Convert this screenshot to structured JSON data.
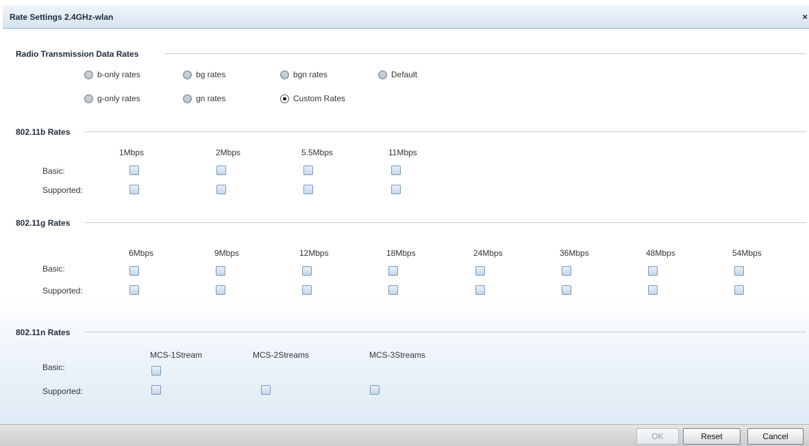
{
  "dialog": {
    "title": "Rate Settings 2.4GHz-wlan",
    "close_glyph": "×"
  },
  "radio_section": {
    "title": "Radio Transmission Data Rates",
    "options": [
      {
        "label": "b-only rates",
        "checked": false
      },
      {
        "label": "bg rates",
        "checked": false
      },
      {
        "label": "bgn rates",
        "checked": false
      },
      {
        "label": "Default",
        "checked": false
      },
      {
        "label": "g-only rates",
        "checked": false
      },
      {
        "label": "gn rates",
        "checked": false
      },
      {
        "label": "Custom Rates",
        "checked": true
      }
    ]
  },
  "b_rates": {
    "title": "802.11b Rates",
    "columns": [
      "1Mbps",
      "2Mbps",
      "5.5Mbps",
      "11Mbps"
    ],
    "row_basic": "Basic:",
    "row_supported": "Supported:"
  },
  "g_rates": {
    "title": "802.11g Rates",
    "columns": [
      "6Mbps",
      "9Mbps",
      "12Mbps",
      "18Mbps",
      "24Mbps",
      "36Mbps",
      "48Mbps",
      "54Mbps"
    ],
    "row_basic": "Basic:",
    "row_supported": "Supported:"
  },
  "n_rates": {
    "title": "802.11n Rates",
    "columns": [
      "MCS-1Stream",
      "MCS-2Streams",
      "MCS-3Streams"
    ],
    "row_basic": "Basic:",
    "row_supported": "Supported:"
  },
  "buttons": {
    "ok": "OK",
    "reset": "Reset",
    "cancel": "Cancel"
  }
}
